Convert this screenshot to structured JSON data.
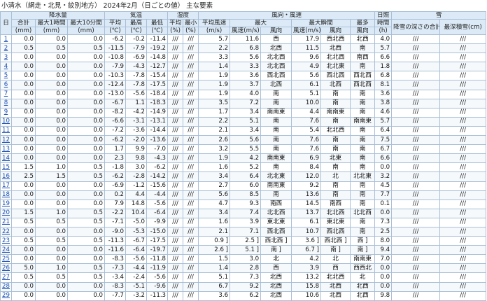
{
  "title": "小清水（網走・北見・紋別地方） 2024年2月（日ごとの値） 主な要素",
  "headers": {
    "day": "日",
    "precip": "降水量",
    "temp": "気温",
    "humidity": "湿度",
    "wind": "風向・風速",
    "sunshine": "日照",
    "snow": "雪",
    "total": "合計",
    "max_1h": "最大1時間",
    "max_10m": "最大10分間",
    "avg": "平均",
    "high": "最高",
    "low": "最低",
    "hum_avg": "平均",
    "hum_min": "最小",
    "avg_wind": "平均風速",
    "max_wind": "最大",
    "max_gust": "最大瞬間",
    "prevailing": "最多",
    "sun_time": "時間",
    "snow_depth": "降雪の深さの合計(cm)",
    "max_snow": "最深積雪(cm)",
    "u_mm1": "(mm)",
    "u_mm2": "(mm)",
    "u_mm3": "(mm)",
    "u_c1": "(℃)",
    "u_c2": "(℃)",
    "u_c3": "(℃)",
    "u_p1": "(%)",
    "u_p2": "(%)",
    "u_ms": "(m/s)",
    "speed1": "風速(m/s)",
    "dir1": "風向",
    "speed2": "風速(m/s)",
    "dir2": "風向",
    "dir3": "風向",
    "u_h": "(h)"
  },
  "rows": [
    [
      "1",
      "0.0",
      "0.0",
      "0.0",
      "-6.2",
      "-0.2",
      "-11.4",
      "///",
      "///",
      "5.7",
      "11.6",
      "西",
      "17.9",
      "西北西",
      "北西",
      "4.0",
      "///",
      "///"
    ],
    [
      "2",
      "0.5",
      "0.5",
      "0.5",
      "-11.5",
      "-7.9",
      "-19.2",
      "///",
      "///",
      "2.2",
      "6.8",
      "北西",
      "11.5",
      "北西",
      "南",
      "5.7",
      "///",
      "///"
    ],
    [
      "3",
      "0.0",
      "0.0",
      "0.0",
      "-10.8",
      "-6.9",
      "-14.8",
      "///",
      "///",
      "3.3",
      "5.6",
      "北北西",
      "9.6",
      "北北西",
      "南西",
      "6.6",
      "///",
      "///"
    ],
    [
      "4",
      "0.0",
      "0.0",
      "0.0",
      "-7.9",
      "-4.3",
      "-12.7",
      "///",
      "///",
      "1.4",
      "3.3",
      "北北西",
      "4.9",
      "北北東",
      "南",
      "1.8",
      "///",
      "///"
    ],
    [
      "5",
      "0.0",
      "0.0",
      "0.0",
      "-10.3",
      "-7.8",
      "-15.4",
      "///",
      "///",
      "1.9",
      "3.6",
      "西北西",
      "5.6",
      "西北西",
      "西北西",
      "6.8",
      "///",
      "///"
    ],
    [
      "6",
      "0.0",
      "0.0",
      "0.0",
      "-12.4",
      "-7.8",
      "-17.5",
      "///",
      "///",
      "1.9",
      "3.7",
      "北西",
      "6.1",
      "北西",
      "西北西",
      "8.1",
      "///",
      "///"
    ],
    [
      "7",
      "0.0",
      "0.0",
      "0.0",
      "-13.0",
      "-5.6",
      "-18.4",
      "///",
      "///",
      "1.9",
      "4.0",
      "南",
      "5.1",
      "南",
      "南",
      "3.6",
      "///",
      "///"
    ],
    [
      "8",
      "0.0",
      "0.0",
      "0.0",
      "-6.7",
      "1.1",
      "-18.3",
      "///",
      "///",
      "3.5",
      "7.2",
      "南",
      "10.0",
      "南",
      "南",
      "3.8",
      "///",
      "///"
    ],
    [
      "9",
      "0.0",
      "0.0",
      "0.0",
      "-8.2",
      "-4.2",
      "-14.9",
      "///",
      "///",
      "1.7",
      "3.4",
      "南南東",
      "4.4",
      "南南東",
      "南",
      "4.6",
      "///",
      "///"
    ],
    [
      "10",
      "0.0",
      "0.0",
      "0.0",
      "-6.6",
      "-3.1",
      "-13.1",
      "///",
      "///",
      "2.2",
      "5.1",
      "南",
      "7.6",
      "南",
      "南南東",
      "5.7",
      "///",
      "///"
    ],
    [
      "11",
      "0.0",
      "0.0",
      "0.0",
      "-7.2",
      "-3.6",
      "-14.4",
      "///",
      "///",
      "2.1",
      "3.4",
      "南",
      "5.4",
      "北北西",
      "南",
      "6.4",
      "///",
      "///"
    ],
    [
      "12",
      "0.0",
      "0.0",
      "0.0",
      "-6.2",
      "-2.0",
      "-13.6",
      "///",
      "///",
      "2.6",
      "5.6",
      "南",
      "7.6",
      "南",
      "南",
      "7.5",
      "///",
      "///"
    ],
    [
      "13",
      "0.0",
      "0.0",
      "0.0",
      "1.7",
      "9.9",
      "-7.0",
      "///",
      "///",
      "3.2",
      "5.5",
      "南",
      "7.6",
      "南",
      "南",
      "6.7",
      "///",
      "///"
    ],
    [
      "14",
      "0.0",
      "0.0",
      "0.0",
      "2.3",
      "9.8",
      "-4.3",
      "///",
      "///",
      "1.9",
      "4.2",
      "南南東",
      "6.9",
      "北東",
      "南",
      "6.6",
      "///",
      "///"
    ],
    [
      "15",
      "1.5",
      "1.0",
      "0.5",
      "-1.8",
      "3.0",
      "-6.2",
      "///",
      "///",
      "1.6",
      "5.2",
      "南",
      "8.4",
      "南",
      "南",
      "0.0",
      "///",
      "///"
    ],
    [
      "16",
      "2.5",
      "1.5",
      "0.5",
      "-6.2",
      "-2.8",
      "-14.2",
      "///",
      "///",
      "3.4",
      "6.4",
      "北北東",
      "12.0",
      "北",
      "北北東",
      "3.2",
      "///",
      "///"
    ],
    [
      "17",
      "0.0",
      "0.0",
      "0.0",
      "-6.9",
      "-1.2",
      "-15.6",
      "///",
      "///",
      "2.7",
      "6.0",
      "南南東",
      "9.2",
      "南",
      "南",
      "4.5",
      "///",
      "///"
    ],
    [
      "18",
      "0.0",
      "0.0",
      "0.0",
      "0.2",
      "4.4",
      "-4.4",
      "///",
      "///",
      "5.6",
      "8.5",
      "南",
      "13.6",
      "南",
      "南",
      "7.7",
      "///",
      "///"
    ],
    [
      "19",
      "0.0",
      "0.0",
      "0.0",
      "7.9",
      "14.8",
      "-5.6",
      "///",
      "///",
      "4.7",
      "9.3",
      "南西",
      "14.5",
      "南西",
      "南",
      "0.1",
      "///",
      "///"
    ],
    [
      "20",
      "1.5",
      "1.0",
      "0.5",
      "-2.2",
      "10.4",
      "-6.4",
      "///",
      "///",
      "3.4",
      "7.4",
      "北北西",
      "13.7",
      "北北西",
      "北北西",
      "0.0",
      "///",
      "///"
    ],
    [
      "21",
      "0.5",
      "0.5",
      "0.5",
      "-7.1",
      "-5.0",
      "-9.9",
      "///",
      "///",
      "1.6",
      "3.9",
      "東北東",
      "6.1",
      "東北東",
      "南",
      "7.3",
      "///",
      "///"
    ],
    [
      "22",
      "0.0",
      "0.0",
      "0.0",
      "-9.0",
      "-5.3",
      "-15.0",
      "///",
      "///",
      "2.1",
      "7.1",
      "西北西",
      "10.7",
      "西北西",
      "南",
      "2.5",
      "///",
      "///"
    ],
    [
      "23",
      "0.5",
      "0.5",
      "0.5",
      "-11.3",
      "-6.7",
      "-17.5",
      "///",
      "///",
      "0.9 ]",
      "2.5 ]",
      "西北西 ]",
      "3.6 ]",
      "西北西 ]",
      "西 ]",
      "8.0",
      "///",
      "///"
    ],
    [
      "24",
      "0.0",
      "0.0",
      "0.0",
      "-11.6",
      "-6.4",
      "-19.7",
      "///",
      "///",
      "2.6 ]",
      "5.1 ]",
      "南 ]",
      "6.7 ]",
      "南 ]",
      "南 ]",
      "9.4",
      "///",
      "///"
    ],
    [
      "25",
      "0.0",
      "0.0",
      "0.0",
      "-8.3",
      "-5.6",
      "-11.8",
      "///",
      "///",
      "1.5",
      "3.0",
      "北",
      "4.2",
      "北",
      "南南東",
      "7.0",
      "///",
      "///"
    ],
    [
      "26",
      "5.0",
      "1.0",
      "0.5",
      "-7.3",
      "-4.4",
      "-11.9",
      "///",
      "///",
      "1.4",
      "2.8",
      "西",
      "3.9",
      "西",
      "西西北",
      "0.0",
      "///",
      "///"
    ],
    [
      "27",
      "0.5",
      "0.5",
      "0.5",
      "-3.4",
      "-2.4",
      "-5.6",
      "///",
      "///",
      "5.1",
      "7.3",
      "北西",
      "13.2",
      "北北西",
      "北",
      "0.0",
      "///",
      "///"
    ],
    [
      "28",
      "0.0",
      "0.0",
      "0.0",
      "-8.3",
      "-5.1",
      "-9.6",
      "///",
      "///",
      "6.7",
      "9.2",
      "北西",
      "15.8",
      "北西",
      "北西",
      "0.0",
      "///",
      "///"
    ],
    [
      "29",
      "0.0",
      "0.0",
      "0.0",
      "-7.7",
      "-3.2",
      "-11.3",
      "///",
      "///",
      "3.6",
      "6.2",
      "北西",
      "10.6",
      "北西",
      "北西",
      "9.8",
      "///",
      "///"
    ]
  ]
}
